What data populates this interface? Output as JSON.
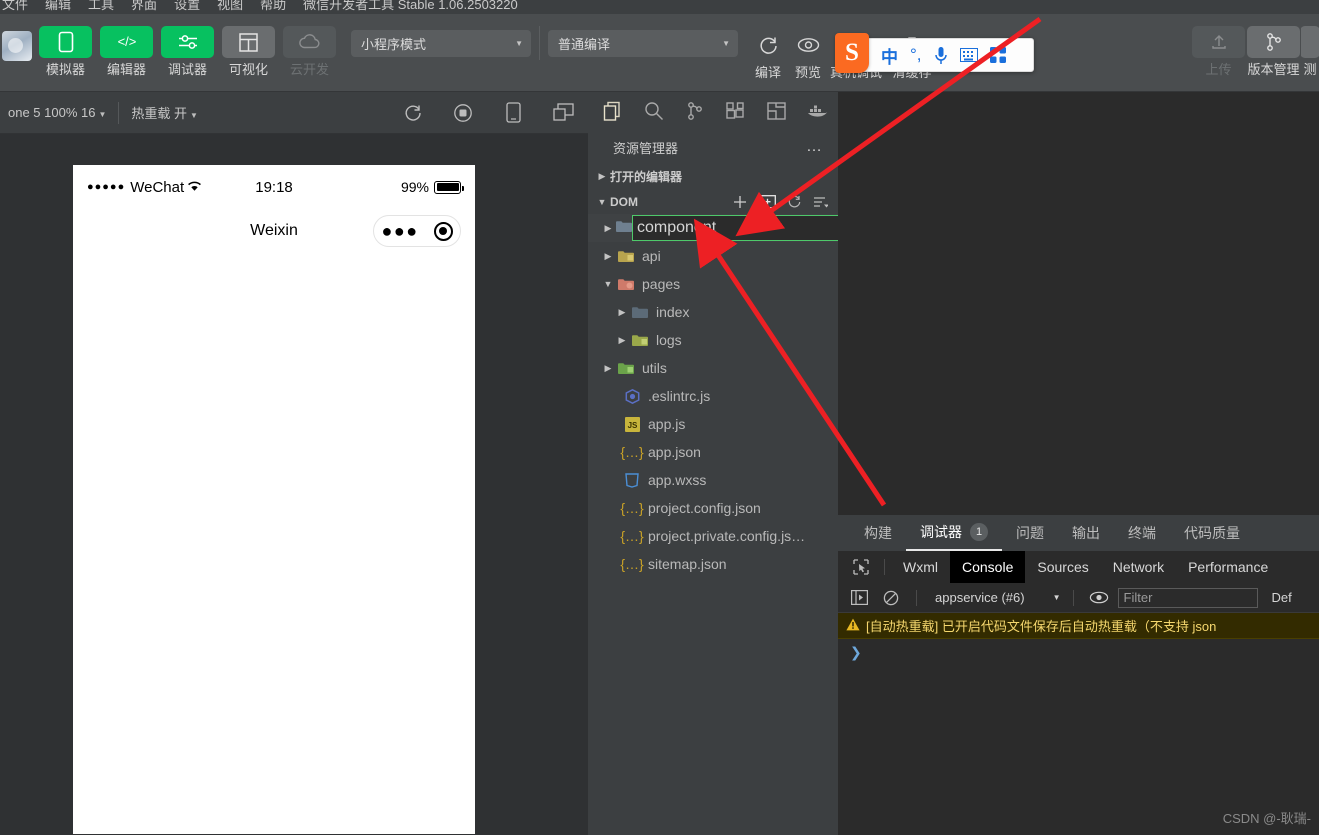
{
  "menubar": {
    "items": [
      "文件",
      "编辑",
      "工具",
      "界面",
      "设置",
      "视图",
      "帮助"
    ],
    "title_right": "微信开发者工具 Stable 1.06.2503220"
  },
  "toolbar": {
    "buttons": [
      {
        "label": "模拟器",
        "icon": "phone-icon",
        "style": "green",
        "disabled": false
      },
      {
        "label": "编辑器",
        "icon": "code-icon",
        "style": "green",
        "disabled": false
      },
      {
        "label": "调试器",
        "icon": "debug-icon",
        "style": "green",
        "disabled": false
      },
      {
        "label": "可视化",
        "icon": "layout-icon",
        "style": "grey",
        "disabled": false
      },
      {
        "label": "云开发",
        "icon": "cloud-icon",
        "style": "grey",
        "disabled": true
      }
    ],
    "mode_select": "小程序模式",
    "compile_select": "普通编译",
    "actions": [
      {
        "label": "编译",
        "icon": "refresh-icon"
      },
      {
        "label": "预览",
        "icon": "eye-icon"
      },
      {
        "label": "真机调试",
        "icon": "device-debug-icon"
      },
      {
        "label": "清缓存",
        "icon": "clear-cache-icon"
      }
    ],
    "right_actions": [
      {
        "label": "上传",
        "icon": "upload-icon",
        "disabled": true
      },
      {
        "label": "版本管理",
        "icon": "branch-icon",
        "disabled": false
      },
      {
        "label": "测",
        "icon": "test-icon",
        "disabled": false
      }
    ]
  },
  "ime": {
    "logo": "S",
    "items": [
      "中",
      "°,",
      "mic-icon",
      "keyboard-icon",
      "apps-icon"
    ]
  },
  "simulator_bar": {
    "device": "one 5 100% 16",
    "hot_reload": "热重载 开",
    "icons": [
      "refresh-icon",
      "record-icon",
      "phone-icon",
      "split-icon"
    ]
  },
  "phone": {
    "carrier": "WeChat",
    "signal_dots": "●●●●●",
    "time": "19:18",
    "battery_pct": "99%",
    "title": "Weixin",
    "capsule_dots": "●●●"
  },
  "explorer": {
    "activity_icons": [
      "files-icon",
      "search-icon",
      "source-control-icon",
      "extensions-icon",
      "layout-icon",
      "docker-icon"
    ],
    "header_title": "资源管理器",
    "header_more": "…",
    "sections": [
      {
        "label": "打开的编辑器",
        "expanded": false
      },
      {
        "label": "DOM",
        "expanded": true
      }
    ],
    "dom_actions": [
      "new-file-icon",
      "new-folder-icon",
      "refresh-icon",
      "collapse-all-icon"
    ],
    "new_folder_value": "component",
    "tree": [
      {
        "name": "api",
        "type": "folder",
        "depth": 1,
        "expanded": false,
        "color": "#b8a44e"
      },
      {
        "name": "pages",
        "type": "folder",
        "depth": 1,
        "expanded": true,
        "color": "#cf7a6a"
      },
      {
        "name": "index",
        "type": "folder",
        "depth": 2,
        "expanded": false,
        "color": "#5c6b78"
      },
      {
        "name": "logs",
        "type": "folder",
        "depth": 2,
        "expanded": false,
        "color": "#9aa84a"
      },
      {
        "name": "utils",
        "type": "folder",
        "depth": 1,
        "expanded": false,
        "color": "#6ba34a"
      },
      {
        "name": ".eslintrc.js",
        "type": "eslint",
        "depth": 1
      },
      {
        "name": "app.js",
        "type": "js",
        "depth": 1
      },
      {
        "name": "app.json",
        "type": "json",
        "depth": 1
      },
      {
        "name": "app.wxss",
        "type": "css",
        "depth": 1
      },
      {
        "name": "project.config.json",
        "type": "json",
        "depth": 1
      },
      {
        "name": "project.private.config.js…",
        "type": "json",
        "depth": 1
      },
      {
        "name": "sitemap.json",
        "type": "json",
        "depth": 1
      }
    ]
  },
  "debugger": {
    "tabs": [
      {
        "label": "构建",
        "active": false,
        "badge": null
      },
      {
        "label": "调试器",
        "active": true,
        "badge": "1"
      },
      {
        "label": "问题",
        "active": false,
        "badge": null
      },
      {
        "label": "输出",
        "active": false,
        "badge": null
      },
      {
        "label": "终端",
        "active": false,
        "badge": null
      },
      {
        "label": "代码质量",
        "active": false,
        "badge": null
      }
    ],
    "devtools_tabs": [
      {
        "label": "Wxml",
        "active": false
      },
      {
        "label": "Console",
        "active": true
      },
      {
        "label": "Sources",
        "active": false
      },
      {
        "label": "Network",
        "active": false
      },
      {
        "label": "Performance",
        "active": false
      }
    ],
    "console": {
      "context": "appservice (#6)",
      "filter_placeholder": "Filter",
      "levels_label": "Def",
      "warning": "[自动热重载] 已开启代码文件保存后自动热重载（不支持 json",
      "warning_mono": "json",
      "prompt": "❯"
    }
  },
  "watermark": "CSDN @-耿瑞-",
  "colors": {
    "accent_green": "#07c160",
    "arrow_red": "#ed2024",
    "input_border": "#4ec96a",
    "panel_bg": "#3c3f41",
    "editor_bg": "#2b2b2b"
  }
}
